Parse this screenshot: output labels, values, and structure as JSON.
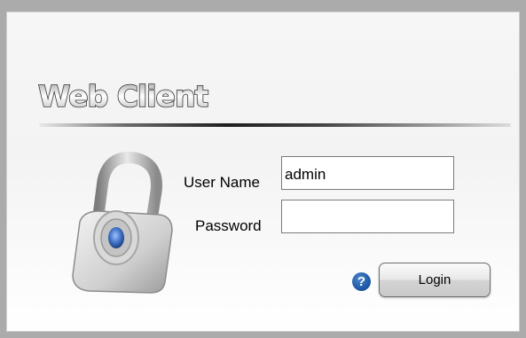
{
  "app": {
    "logo_text": "Web Client"
  },
  "form": {
    "username_label": "User Name",
    "username_value": "admin",
    "password_label": "Password",
    "password_value": "",
    "help_symbol": "?",
    "login_label": "Login"
  },
  "icons": {
    "lock": "padlock-icon",
    "help": "question-icon"
  },
  "colors": {
    "frame": "#ababab",
    "help_blue": "#1f5aa8"
  }
}
